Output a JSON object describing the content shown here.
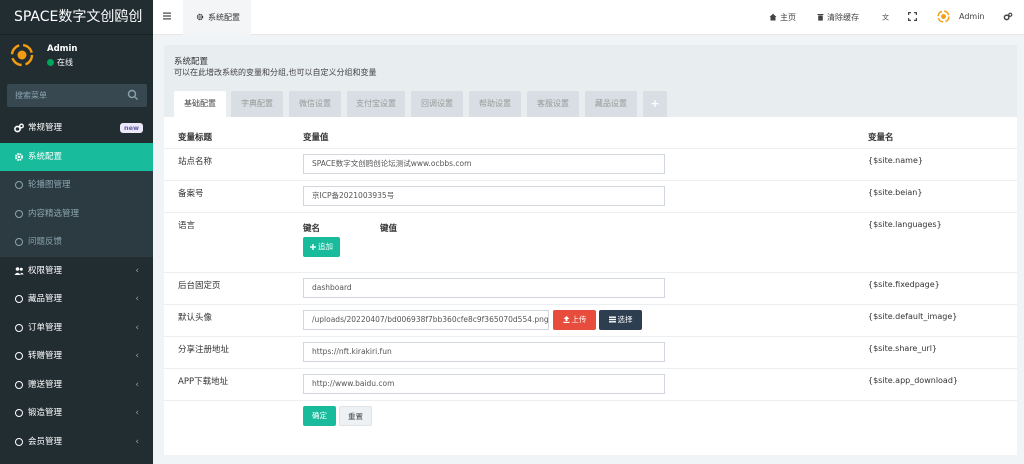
{
  "app": {
    "title": "SPACE数字文创鸥创"
  },
  "user": {
    "name": "Admin",
    "status": "在线"
  },
  "search": {
    "placeholder": "搜索菜单"
  },
  "menu": [
    {
      "label": "常规管理",
      "badge": "new",
      "icon": "gears-icon",
      "type": "parent"
    },
    {
      "label": "系统配置",
      "icon": "gear-icon",
      "type": "active"
    },
    {
      "label": "轮播图管理",
      "type": "sub"
    },
    {
      "label": "内容精选管理",
      "type": "sub"
    },
    {
      "label": "问题反馈",
      "type": "sub"
    },
    {
      "label": "权限管理",
      "icon": "users-icon",
      "type": "parent",
      "arrow": "‹"
    },
    {
      "label": "藏品管理",
      "type": "parent",
      "arrow": "‹"
    },
    {
      "label": "订单管理",
      "type": "parent",
      "arrow": "‹"
    },
    {
      "label": "转赠管理",
      "type": "parent",
      "arrow": "‹"
    },
    {
      "label": "赠送管理",
      "type": "parent",
      "arrow": "‹"
    },
    {
      "label": "锻造管理",
      "type": "parent",
      "arrow": "‹"
    },
    {
      "label": "会员管理",
      "type": "parent",
      "arrow": "‹"
    }
  ],
  "navbar": {
    "tab_label": "系统配置",
    "home": "主页",
    "clear_cache": "清除缓存",
    "admin": "Admin"
  },
  "panel": {
    "title": "系统配置",
    "subtitle": "可以在此增改系统的变量和分组,也可以自定义分组和变量",
    "tabs": [
      "基础配置",
      "字典配置",
      "微信设置",
      "支付宝设置",
      "回调设置",
      "帮助设置",
      "客服设置",
      "藏品设置",
      "+"
    ]
  },
  "table": {
    "headers": {
      "title": "变量标题",
      "value": "变量值",
      "name": "变量名"
    },
    "rows": [
      {
        "label": "站点名称",
        "value": "SPACE数字文创鸥创论坛测试www.ocbbs.com",
        "var": "{$site.name}"
      },
      {
        "label": "备案号",
        "value": "京ICP备2021003935号",
        "var": "{$site.beian}"
      },
      {
        "label": "语言",
        "key_label": "键名",
        "val_label": "键值",
        "add": "追加",
        "var": "{$site.languages}"
      },
      {
        "label": "后台固定页",
        "value": "dashboard",
        "var": "{$site.fixedpage}"
      },
      {
        "label": "默认头像",
        "value": "/uploads/20220407/bd006938f7bb360cfe8c9f365070d554.png",
        "upload": "上传",
        "choose": "选择",
        "var": "{$site.default_image}"
      },
      {
        "label": "分享注册地址",
        "value": "https://nft.kirakiri.fun",
        "var": "{$site.share_url}"
      },
      {
        "label": "APP下载地址",
        "value": "http://www.baidu.com",
        "var": "{$site.app_download}"
      }
    ],
    "submit": "确定",
    "reset": "重置"
  },
  "colors": {
    "sidebar": "#222d32",
    "accent": "#18bc9c",
    "danger": "#e74c3c",
    "dark_button": "#2c3e50"
  }
}
